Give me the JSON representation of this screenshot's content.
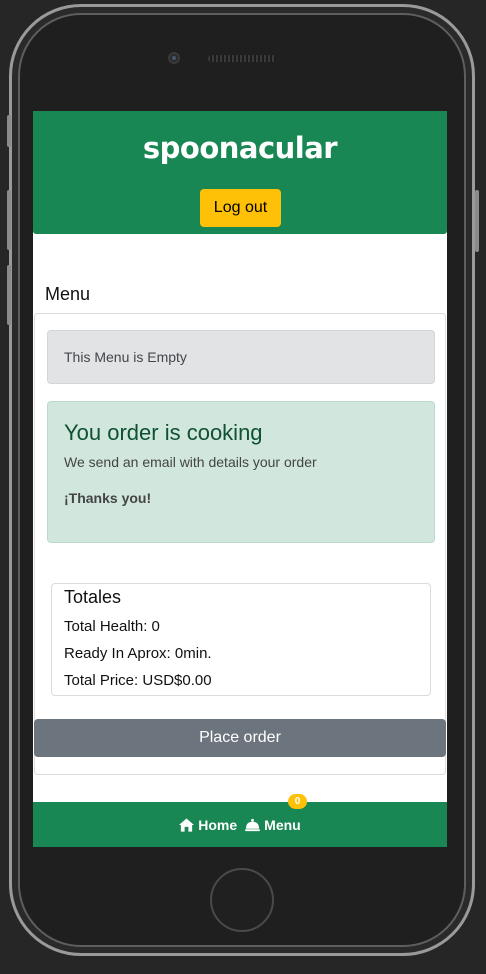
{
  "header": {
    "logo_text": "spoonacular",
    "logout_label": "Log out"
  },
  "menu": {
    "title": "Menu",
    "empty_text": "This Menu is Empty"
  },
  "order_alert": {
    "heading": "You order is cooking",
    "message": "We send an email with details your order",
    "thanks": "¡Thanks you!"
  },
  "totals": {
    "title": "Totales",
    "health": "Total Health: 0",
    "ready": "Ready In Aprox: 0min.",
    "price": "Total Price: USD$0.00"
  },
  "actions": {
    "place_order_label": "Place order"
  },
  "bottom_nav": {
    "home_label": "Home",
    "menu_label": "Menu",
    "menu_badge": "0"
  },
  "colors": {
    "brand_green": "#198754",
    "warning_yellow": "#ffc107",
    "secondary_gray": "#6c757d",
    "success_bg": "#d1e7dd"
  },
  "icons": {
    "home": "home-icon",
    "menu": "cloche-icon"
  }
}
